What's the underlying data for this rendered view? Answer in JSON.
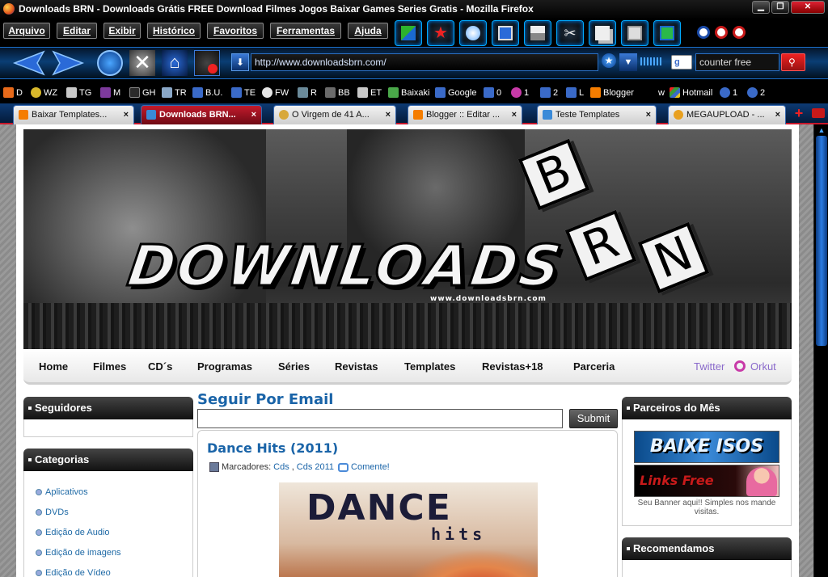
{
  "window": {
    "title": "Downloads BRN - Downloads Grátis FREE Download Filmes Jogos Baixar Games Series Gratis - Mozilla Firefox"
  },
  "menus": [
    "Arquivo",
    "Editar",
    "Exibir",
    "Histórico",
    "Favoritos",
    "Ferramentas",
    "Ajuda"
  ],
  "address": {
    "url": "http://www.downloadsbrn.com/"
  },
  "search": {
    "value": "counter free"
  },
  "bookmarks": [
    {
      "label": "D",
      "icon": "bookmark-d-icon",
      "color": "#e86a1a"
    },
    {
      "label": "WZ",
      "icon": "bookmark-wz-icon",
      "color": "#d9b82b"
    },
    {
      "label": "TG",
      "icon": "bookmark-tg-icon",
      "color": "#c9c9c9"
    },
    {
      "label": "M",
      "icon": "bookmark-m-icon",
      "color": "#7d3a9c"
    },
    {
      "label": "GH",
      "icon": "bookmark-gh-icon",
      "color": "#2a2a2a"
    },
    {
      "label": "TR",
      "icon": "bookmark-tr-icon",
      "color": "#8aa8c8"
    },
    {
      "label": "B.U.",
      "icon": "bookmark-bu-icon",
      "color": "#3a6ac8"
    },
    {
      "label": "TE",
      "icon": "bookmark-te-icon",
      "color": "#3a6ac8"
    },
    {
      "label": "FW",
      "icon": "bookmark-fw-icon",
      "color": "#e6e6e6"
    },
    {
      "label": "R",
      "icon": "bookmark-r-icon",
      "color": "#6a8a9a"
    },
    {
      "label": "BB",
      "icon": "bookmark-bb-icon",
      "color": "#6a6a6a"
    },
    {
      "label": "ET",
      "icon": "bookmark-et-icon",
      "color": "#c8c8c8"
    },
    {
      "label": "Baixaki",
      "icon": "bookmark-baixaki-icon",
      "color": "#4aa84a"
    },
    {
      "label": "Google",
      "icon": "bookmark-google-icon",
      "color": "#3a6ac8"
    },
    {
      "label": "0",
      "icon": "bookmark-0-icon",
      "color": "#3a6ac8"
    },
    {
      "label": "1",
      "icon": "bookmark-orkut-1-icon",
      "color": "#c83aa8"
    },
    {
      "label": "2",
      "icon": "bookmark-2-icon",
      "color": "#3a6ac8"
    },
    {
      "label": "L",
      "icon": "bookmark-l-icon",
      "color": "#3a6ac8"
    },
    {
      "label": "Blogger",
      "icon": "blogger-icon",
      "color": "#f57d00"
    },
    {
      "label": "w",
      "icon": "bookmark-w-icon",
      "color": "#000"
    },
    {
      "label": "Hotmail",
      "icon": "windows-icon",
      "color": "#3a9a3a"
    },
    {
      "label": "1",
      "icon": "msn-1-icon",
      "color": "#3a6ac8"
    },
    {
      "label": "2",
      "icon": "msn-2-icon",
      "color": "#3a6ac8"
    }
  ],
  "tabs": [
    {
      "label": "Baixar Templates...",
      "icon": "blogger-icon",
      "color": "#f57d00",
      "active": false
    },
    {
      "label": "Downloads BRN...",
      "icon": "download-arrow-icon",
      "color": "#3a8ad8",
      "active": true
    },
    {
      "label": "O Virgem de 41 A...",
      "icon": "site-favicon-icon",
      "color": "#d8a83a",
      "active": false
    },
    {
      "label": "Blogger :: Editar ...",
      "icon": "blogger-icon",
      "color": "#f57d00",
      "active": false
    },
    {
      "label": "Teste Templates",
      "icon": "download-arrow-icon",
      "color": "#3a8ad8",
      "active": false
    },
    {
      "label": "MEGAUPLOAD - ...",
      "icon": "megaupload-icon",
      "color": "#e8a020",
      "active": false
    }
  ],
  "site": {
    "logo": "DOWNLOADS",
    "logo_letters": [
      "B",
      "R",
      "N"
    ],
    "logo_sub": "www.downloadsbrn.com",
    "nav": [
      "Home",
      "Filmes",
      "CD´s",
      "Programas",
      "Séries",
      "Revistas",
      "Templates",
      "Revistas+18",
      "Parceria"
    ],
    "social": {
      "twitter": "Twitter",
      "orkut": "Orkut"
    }
  },
  "sidebar_left": {
    "followers_title": "Seguidores",
    "categories_title": "Categorias",
    "categories": [
      "Aplicativos",
      "DVDs",
      "Edição de Audio",
      "Edição de imagens",
      "Edição de Vídeo"
    ]
  },
  "main": {
    "follow_title": "Seguir Por Email",
    "email_placeholder": "",
    "submit_label": "Submit",
    "post": {
      "title": "Dance Hits (2011)",
      "labels_prefix": "Marcadores:",
      "labels": [
        "Cds",
        "Cds 2011"
      ],
      "comment": "Comente!",
      "cover_title": "DANCE",
      "cover_sub": "hits"
    }
  },
  "sidebar_right": {
    "partners_title": "Parceiros do Mês",
    "ad1": "BAIXE ISOS",
    "ad2": "Links Free",
    "banner_note": "Seu Banner aqui!! Simples nos mande visitas.",
    "recommend_title": "Recomendamos"
  }
}
